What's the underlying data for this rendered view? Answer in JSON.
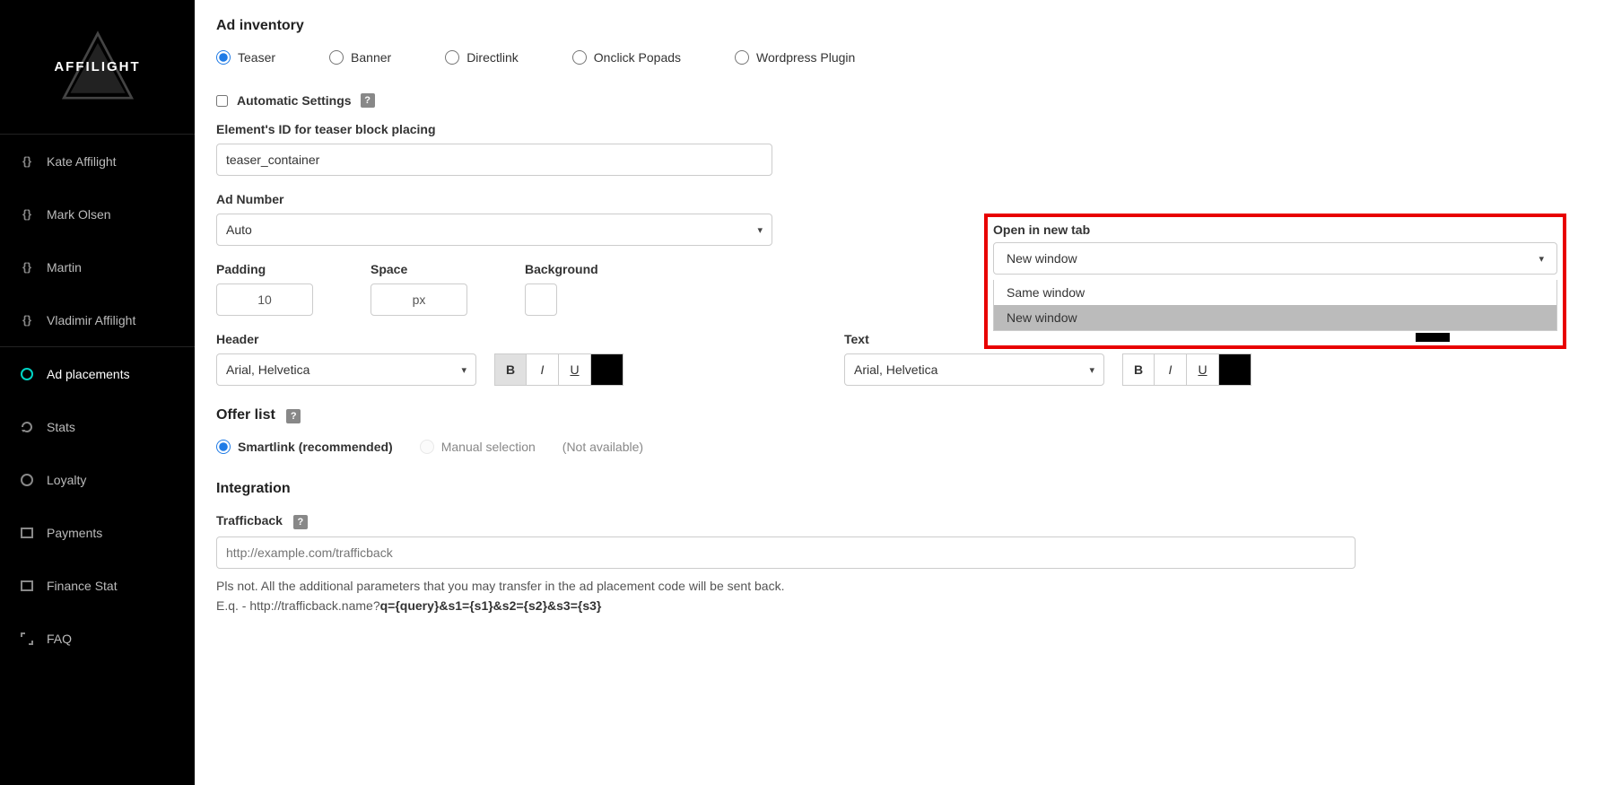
{
  "brand": "AFFILIGHT",
  "sidebar": {
    "profiles": [
      {
        "label": "Kate Affilight"
      },
      {
        "label": "Mark Olsen"
      },
      {
        "label": "Martin"
      },
      {
        "label": "Vladimir Affilight"
      }
    ],
    "nav": [
      {
        "label": "Ad placements",
        "active": true
      },
      {
        "label": "Stats"
      },
      {
        "label": "Loyalty"
      },
      {
        "label": "Payments"
      },
      {
        "label": "Finance Stat"
      },
      {
        "label": "FAQ"
      }
    ]
  },
  "inventory": {
    "title": "Ad inventory",
    "options": [
      "Teaser",
      "Banner",
      "Directlink",
      "Onclick Popads",
      "Wordpress Plugin"
    ],
    "selected": "Teaser"
  },
  "automatic": {
    "label": "Automatic Settings"
  },
  "element_id": {
    "label": "Element's ID for teaser block placing",
    "value": "teaser_container"
  },
  "ad_number": {
    "label": "Ad Number",
    "value": "Auto"
  },
  "padding": {
    "label": "Padding",
    "value": "10"
  },
  "space": {
    "label": "Space",
    "value": "px"
  },
  "background": {
    "label": "Background"
  },
  "open_tab": {
    "label": "Open in new tab",
    "value": "New window",
    "options": [
      "Same window",
      "New window"
    ],
    "highlighted": "New window"
  },
  "header": {
    "label": "Header",
    "font": "Arial, Helvetica",
    "bold_active": true
  },
  "text": {
    "label": "Text",
    "font": "Arial, Helvetica",
    "bold_active": false
  },
  "style_buttons": {
    "bold": "B",
    "italic": "I",
    "underline": "U"
  },
  "offer": {
    "title": "Offer list",
    "smartlink": "Smartlink (recommended)",
    "manual": "Manual selection",
    "note": "(Not available)"
  },
  "integration": {
    "title": "Integration",
    "trafficback_label": "Trafficback",
    "trafficback_placeholder": "http://example.com/trafficback",
    "hint1": "Pls not. All the additional parameters that you may transfer in the ad placement code will be sent back.",
    "hint2_prefix": "E.q. - http://trafficback.name?",
    "hint2_bold": "q={query}&s1={s1}&s2={s2}&s3={s3}"
  }
}
